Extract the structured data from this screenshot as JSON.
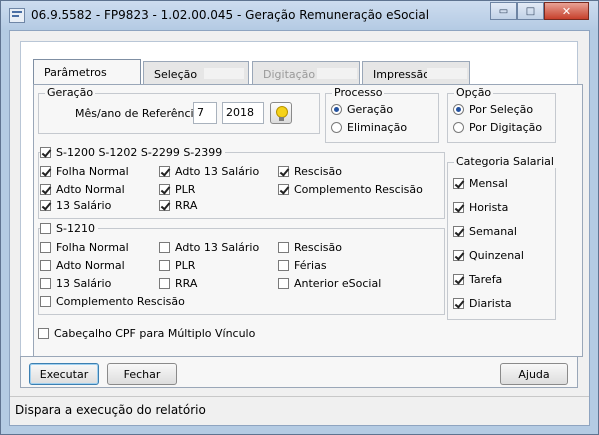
{
  "window": {
    "title": "06.9.5582 - FP9823 - 1.02.00.045 - Geração Remuneração eSocial",
    "minimize_glyph": "▭",
    "maximize_glyph": "□",
    "close_glyph": "✕"
  },
  "tabs": [
    {
      "label": "Parâmetros",
      "state": "active"
    },
    {
      "label": "Seleção",
      "state": "inactive"
    },
    {
      "label": "Digitação",
      "state": "disabled"
    },
    {
      "label": "Impressão",
      "state": "inactive"
    }
  ],
  "geracao": {
    "legend": "Geração",
    "ref_label": "Mês/ano de Referência:",
    "month": "7",
    "year": "2018",
    "lookup_icon": "lightbulb-icon"
  },
  "processo": {
    "legend": "Processo",
    "options": [
      {
        "label": "Geração",
        "selected": true
      },
      {
        "label": "Eliminação",
        "selected": false
      }
    ]
  },
  "opcao": {
    "legend": "Opção",
    "options": [
      {
        "label": "Por Seleção",
        "selected": true
      },
      {
        "label": "Por Digitação",
        "selected": false
      }
    ]
  },
  "group1": {
    "label": "S-1200 S-1202 S-2299 S-2399",
    "checked": true,
    "items": [
      {
        "label": "Folha Normal",
        "checked": true
      },
      {
        "label": "Adto 13 Salário",
        "checked": true
      },
      {
        "label": "Rescisão",
        "checked": true
      },
      {
        "label": "Adto Normal",
        "checked": true
      },
      {
        "label": "PLR",
        "checked": true
      },
      {
        "label": "Complemento Rescisão",
        "checked": true
      },
      {
        "label": "13 Salário",
        "checked": true
      },
      {
        "label": "RRA",
        "checked": true
      }
    ]
  },
  "group2": {
    "label": "S-1210",
    "checked": false,
    "items": [
      {
        "label": "Folha Normal",
        "checked": false
      },
      {
        "label": "Adto 13 Salário",
        "checked": false
      },
      {
        "label": "Rescisão",
        "checked": false
      },
      {
        "label": "Adto Normal",
        "checked": false
      },
      {
        "label": "PLR",
        "checked": false
      },
      {
        "label": "Férias",
        "checked": false
      },
      {
        "label": "13 Salário",
        "checked": false
      },
      {
        "label": "RRA",
        "checked": false
      },
      {
        "label": "Anterior eSocial",
        "checked": false
      },
      {
        "label": "Complemento Rescisão",
        "checked": false
      }
    ]
  },
  "categoria": {
    "legend": "Categoria Salarial",
    "items": [
      {
        "label": "Mensal",
        "checked": true
      },
      {
        "label": "Horista",
        "checked": true
      },
      {
        "label": "Semanal",
        "checked": true
      },
      {
        "label": "Quinzenal",
        "checked": true
      },
      {
        "label": "Tarefa",
        "checked": true
      },
      {
        "label": "Diarista",
        "checked": true
      }
    ]
  },
  "cabecalho": {
    "label": "Cabeçalho CPF para Múltiplo Vínculo",
    "checked": false
  },
  "buttons": {
    "executar": "Executar",
    "fechar": "Fechar",
    "ajuda": "Ajuda"
  },
  "status_text": "Dispara a execução do relatório"
}
